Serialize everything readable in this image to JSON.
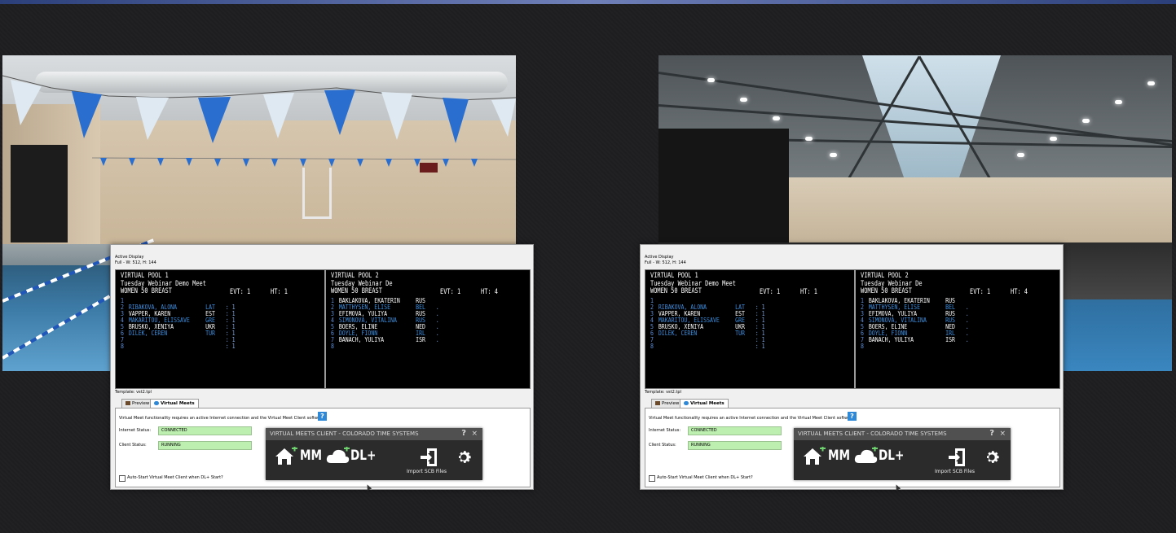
{
  "windows": [
    {
      "title": "Active Display",
      "subtitle": "Full - W: 512, H: 144",
      "pools": [
        {
          "name": "VIRTUAL POOL 1",
          "meet": "Tuesday Webinar Demo Meet",
          "event": "WOMEN 50 BREAST",
          "evt_label": "EVT: 1",
          "ht_label": "HT: 1",
          "rows": [
            {
              "lane": "1",
              "name": "",
              "country": "",
              "time": ""
            },
            {
              "lane": "2",
              "name": "RIBAKOVA, ALONA",
              "country": "LAT",
              "time": ": 1"
            },
            {
              "lane": "3",
              "name": "VAPPER, KAREN",
              "country": "EST",
              "time": ": 1"
            },
            {
              "lane": "4",
              "name": "MAKARITOU, ELISSAVE",
              "country": "GRE",
              "time": ": 1"
            },
            {
              "lane": "5",
              "name": "BRUSKO, XENIYA",
              "country": "UKR",
              "time": ": 1"
            },
            {
              "lane": "6",
              "name": "DILEK, CEREN",
              "country": "TUR",
              "time": ": 1"
            },
            {
              "lane": "7",
              "name": "",
              "country": "",
              "time": ": 1"
            },
            {
              "lane": "8",
              "name": "",
              "country": "",
              "time": ": 1"
            }
          ]
        },
        {
          "name": "VIRTUAL POOL 2",
          "meet": "Tuesday Webinar De",
          "event": "WOMEN 50 BREAST",
          "evt_label": "EVT: 1",
          "ht_label": "HT: 4",
          "rows": [
            {
              "lane": "1",
              "name": "BAKLAKOVA, EKATERIN",
              "country": "RUS",
              "time": ""
            },
            {
              "lane": "2",
              "name": "MATTHYSEN, ELISE",
              "country": "BEL",
              "time": "."
            },
            {
              "lane": "3",
              "name": "EFIMOVA, YULIYA",
              "country": "RUS",
              "time": "."
            },
            {
              "lane": "4",
              "name": "SIMONOVA, VITALINA",
              "country": "RUS",
              "time": "."
            },
            {
              "lane": "5",
              "name": "BOERS, ELINE",
              "country": "NED",
              "time": "."
            },
            {
              "lane": "6",
              "name": "DOYLE, FIONN",
              "country": "IRL",
              "time": "."
            },
            {
              "lane": "7",
              "name": "BANACH, YULIYA",
              "country": "ISR",
              "time": "."
            },
            {
              "lane": "8",
              "name": "",
              "country": "",
              "time": ""
            }
          ]
        }
      ],
      "template_label": "Template: vst2.tpl",
      "tabs": [
        {
          "label": "Preview",
          "active": false
        },
        {
          "label": "Virtual Meets",
          "active": true
        }
      ],
      "notice": "Virtual Meet functionality requires an active Internet connection and the Virtual Meet Client software",
      "internet_status_label": "Internet Status:",
      "internet_status_value": "CONNECTED",
      "client_status_label": "Client Status:",
      "client_status_value": "RUNNING",
      "auto_start_label": "Auto-Start Virtual Meet Client when DL+ Start?",
      "client_window": {
        "title": "VIRTUAL MEETS CLIENT - COLORADO TIME SYSTEMS",
        "help": "?",
        "close": "×",
        "mm_label": "MM",
        "dl_label": "DL+",
        "import_label": "Import SCB Files"
      }
    }
  ],
  "colors": {
    "scoreboard_bg": "#000000",
    "name_highlight": "#3d8fe0",
    "status_ok": "#bdf0b0",
    "client_header": "#505050",
    "top_accent": "#2b3f7a"
  },
  "icons": [
    "home-add-icon",
    "cloud-add-icon",
    "dl-add-icon",
    "import-icon",
    "gear-icon",
    "help-icon",
    "close-icon"
  ]
}
